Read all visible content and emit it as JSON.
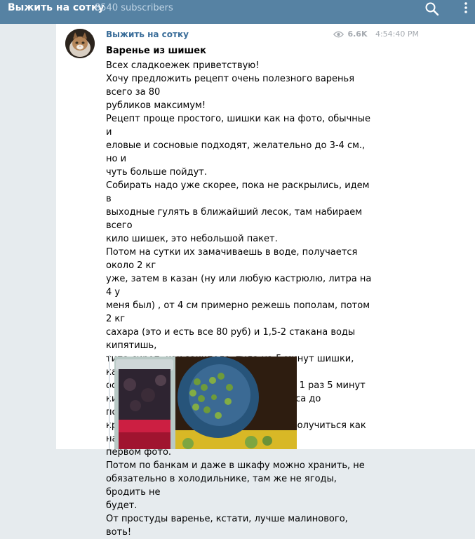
{
  "header": {
    "channel_title": "Выжить на сотку",
    "subscribers": "8540 subscribers",
    "icons": [
      "search-icon",
      "more-vertical-icon"
    ]
  },
  "post": {
    "author": "Выжить на сотку",
    "views": "6.6K",
    "time": "4:54:40 PM",
    "title": "Варенье из шишек",
    "body": "Всех сладкоежек приветствую!\nХочу предложить рецепт очень полезного варенья всего за 80\nрубликов максимум!\nРецепт проще простого, шишки как на фото, обычные и\nеловые и сосновые подходят, желательно до 3-4 см., но и\nчуть больше пойдут.\nСобирать надо уже скорее, пока не раскрылись, идем в\nвыходные гулять в ближайший лесок, там набираем всего\nкило шишек, это небольшой пакет.\nПотом на сутки их замачиваешь в воде, получается около 2 кг\nуже, затем в казан (ну или любую кастрюлю, литра на 4 у\nменя был) , от 4 см примерно режешь пополам, потом 2 кг\nсахара (это и есть все 80 руб) и 1,5-2 стакана воды кипятишь,\nтипа сироп, как закипело, туда на 5 минут шишки, как\nостынет (обычно через сутки), так еще 1 раз 5 минут\nкипятить, последний раз около получаса до появления\nкрасноты и все! Цвет в итоге должен получиться как на\nпервом фото.\nПотом по банкам и даже в шкафу можно хранить, не\nобязательно в холодильнике, там же не ягоды, бродить не\nбудет.\nОт простуды варенье, кстати, лучше малинового, воть!"
  },
  "colors": {
    "header_bg": "#5682a3",
    "author": "#3a6d99",
    "meta": "#a5aab0"
  }
}
